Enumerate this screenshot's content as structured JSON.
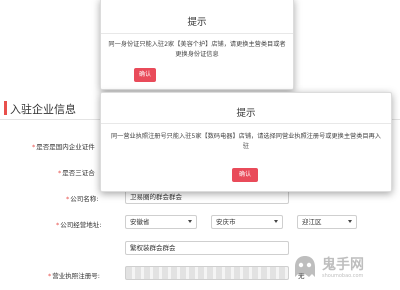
{
  "section": {
    "title": "入驻企业信息"
  },
  "form": {
    "required_mark": "*",
    "labels": {
      "domestic": "是否是国内企业证件",
      "three_in_one": "是否三证合",
      "company_name": "公司名称:",
      "company_address": "公司经营地址:",
      "license_number": "营业执照注册号:"
    },
    "company_name_value": "卫易圈的群会群会",
    "province_value": "安徽省",
    "city_value": "安庆市",
    "district_value": "迎江区",
    "street_value": "繁权装群会群会",
    "license_hint": "无"
  },
  "dialog_back": {
    "title": "提示",
    "message": "同一身份证只能入驻2家【美容个护】店铺，请更换主营类目或者更换身份证信息",
    "confirm_label": "确认"
  },
  "dialog_front": {
    "title": "提示",
    "message": "同一营业执照注册号只能入驻5家【数码电器】店铺，请选择同营业执照注册号或更换主营类目再入驻",
    "confirm_label": "确认"
  },
  "watermark": {
    "brand": "鬼手网",
    "url": "shoumobao.com"
  },
  "colors": {
    "accent": "#e94b5a",
    "section_bar": "#e8504c"
  }
}
